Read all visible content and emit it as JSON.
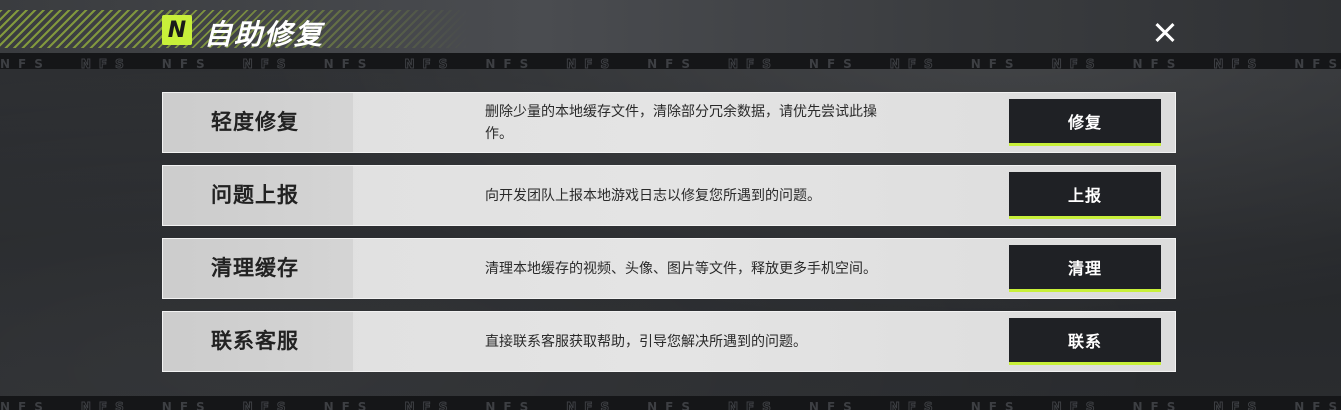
{
  "header": {
    "logo_text": "N",
    "title": "自助修复",
    "close_icon": "close-icon",
    "accent_color": "#c8f03a"
  },
  "watermark": {
    "text": "NFS"
  },
  "rows": [
    {
      "title": "轻度修复",
      "description": "删除少量的本地缓存文件，清除部分冗余数据，请优先尝试此操作。",
      "button": "修复"
    },
    {
      "title": "问题上报",
      "description": "向开发团队上报本地游戏日志以修复您所遇到的问题。",
      "button": "上报"
    },
    {
      "title": "清理缓存",
      "description": "清理本地缓存的视频、头像、图片等文件，释放更多手机空间。",
      "button": "清理"
    },
    {
      "title": "联系客服",
      "description": "直接联系客服获取帮助，引导您解决所遇到的问题。",
      "button": "联系"
    }
  ]
}
